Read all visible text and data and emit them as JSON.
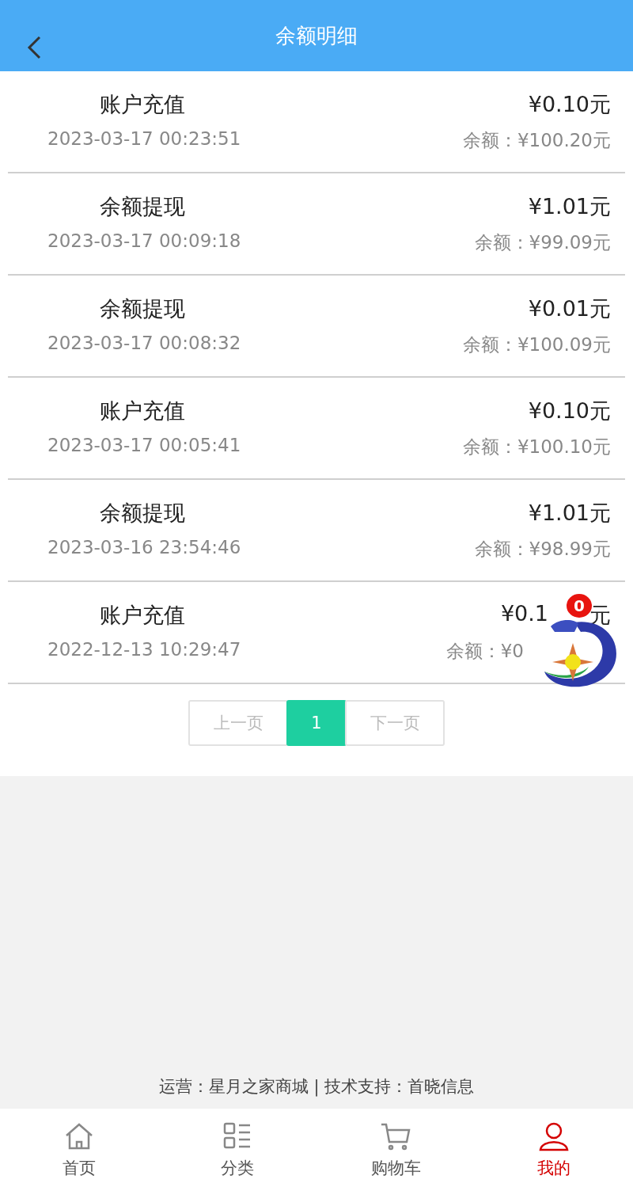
{
  "header": {
    "title": "余额明细"
  },
  "records": [
    {
      "title": "账户充值",
      "time": "2023-03-17 00:23:51",
      "amount": "¥0.10元",
      "balance": "余额：¥100.20元"
    },
    {
      "title": "余额提现",
      "time": "2023-03-17 00:09:18",
      "amount": "¥1.01元",
      "balance": "余额：¥99.09元"
    },
    {
      "title": "余额提现",
      "time": "2023-03-17 00:08:32",
      "amount": "¥0.01元",
      "balance": "余额：¥100.09元"
    },
    {
      "title": "账户充值",
      "time": "2023-03-17 00:05:41",
      "amount": "¥0.10元",
      "balance": "余额：¥100.10元"
    },
    {
      "title": "余额提现",
      "time": "2023-03-16 23:54:46",
      "amount": "¥1.01元",
      "balance": "余额：¥98.99元"
    },
    {
      "title": "账户充值",
      "time": "2022-12-13 10:29:47",
      "amount": "¥0.1",
      "amount_tail": "元",
      "balance": "余额：¥0"
    }
  ],
  "pagination": [
    {
      "label": "上一页",
      "selected": false
    },
    {
      "label": "1",
      "selected": true
    },
    {
      "label": "下一页",
      "selected": false
    }
  ],
  "float_widget": {
    "badge": "0"
  },
  "footer": "运营：星月之家商城 | 技术支持：首晓信息",
  "nav": [
    {
      "kind": "home",
      "label": "首页",
      "selected": false
    },
    {
      "kind": "category",
      "label": "分类",
      "selected": false
    },
    {
      "kind": "cart",
      "label": "购物车",
      "selected": false
    },
    {
      "kind": "user",
      "label": "我的",
      "selected": true
    }
  ]
}
